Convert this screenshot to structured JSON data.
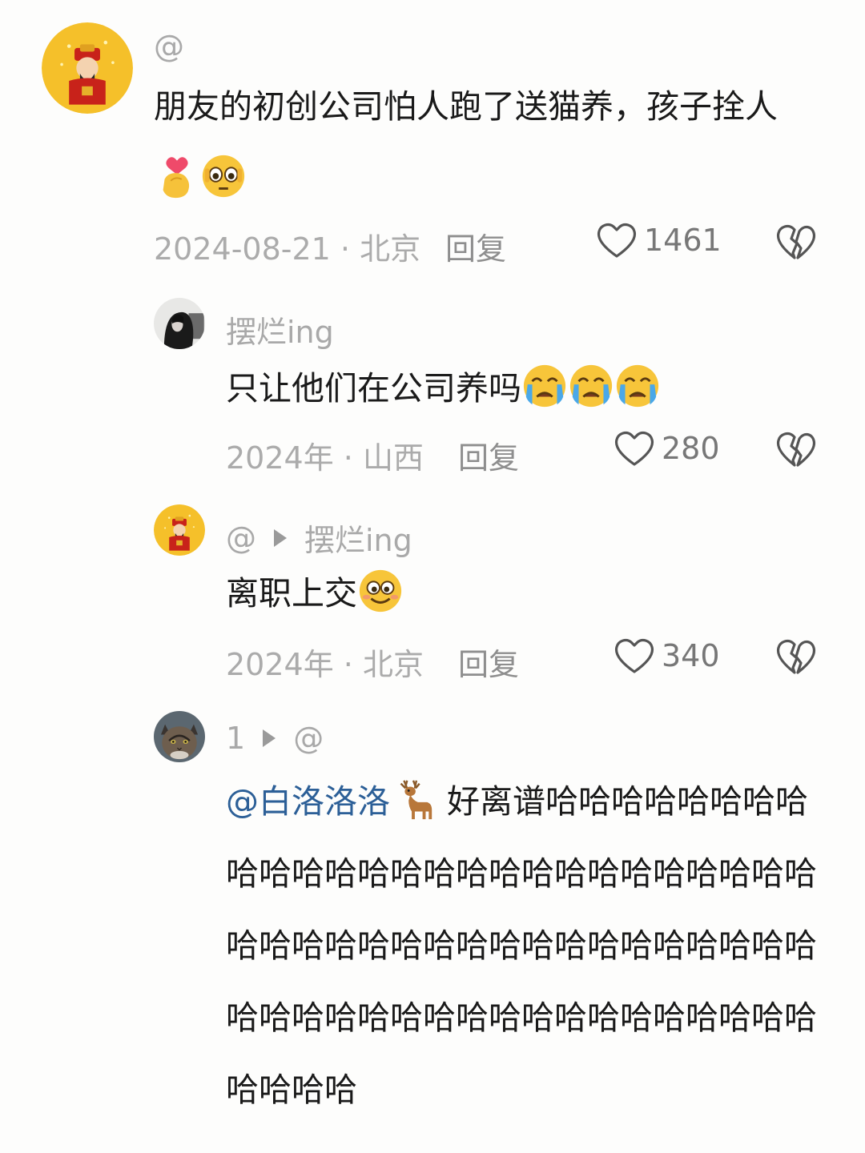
{
  "comments": [
    {
      "username": "@",
      "text": "朋友的初创公司怕人跑了送猫养，孩子拴人",
      "meta": "2024-08-21 · 北京",
      "reply_label": "回复",
      "likes": "1461",
      "emojis": [
        "finger-heart-emoji",
        "pleading-face-emoji"
      ]
    },
    {
      "username": "摆烂ing",
      "text": "只让他们在公司养吗",
      "meta": "2024年 · 山西",
      "reply_label": "回复",
      "likes": "280",
      "emojis": [
        "crying-face-emoji",
        "crying-face-emoji",
        "crying-face-emoji"
      ]
    },
    {
      "username": "@",
      "reply_to": "摆烂ing",
      "text": "离职上交",
      "meta": "2024年 · 北京",
      "reply_label": "回复",
      "likes": "340",
      "emojis": [
        "silly-face-emoji"
      ]
    },
    {
      "username": "1",
      "reply_to": "@",
      "mention": "@白洛洛洛",
      "text_after_deer": " 好离谱哈哈哈哈哈哈哈哈哈哈哈哈哈哈哈哈哈哈哈哈哈哈哈哈哈哈哈哈哈哈哈哈哈哈哈哈哈哈哈哈哈哈哈哈哈哈哈哈哈哈哈哈哈哈哈哈哈哈哈哈哈哈哈哈哈哈",
      "emojis": [
        "deer-emoji"
      ]
    }
  ],
  "colors": {
    "background": "#fdfdfc",
    "mention": "#2c5f97",
    "meta": "#ababab"
  }
}
